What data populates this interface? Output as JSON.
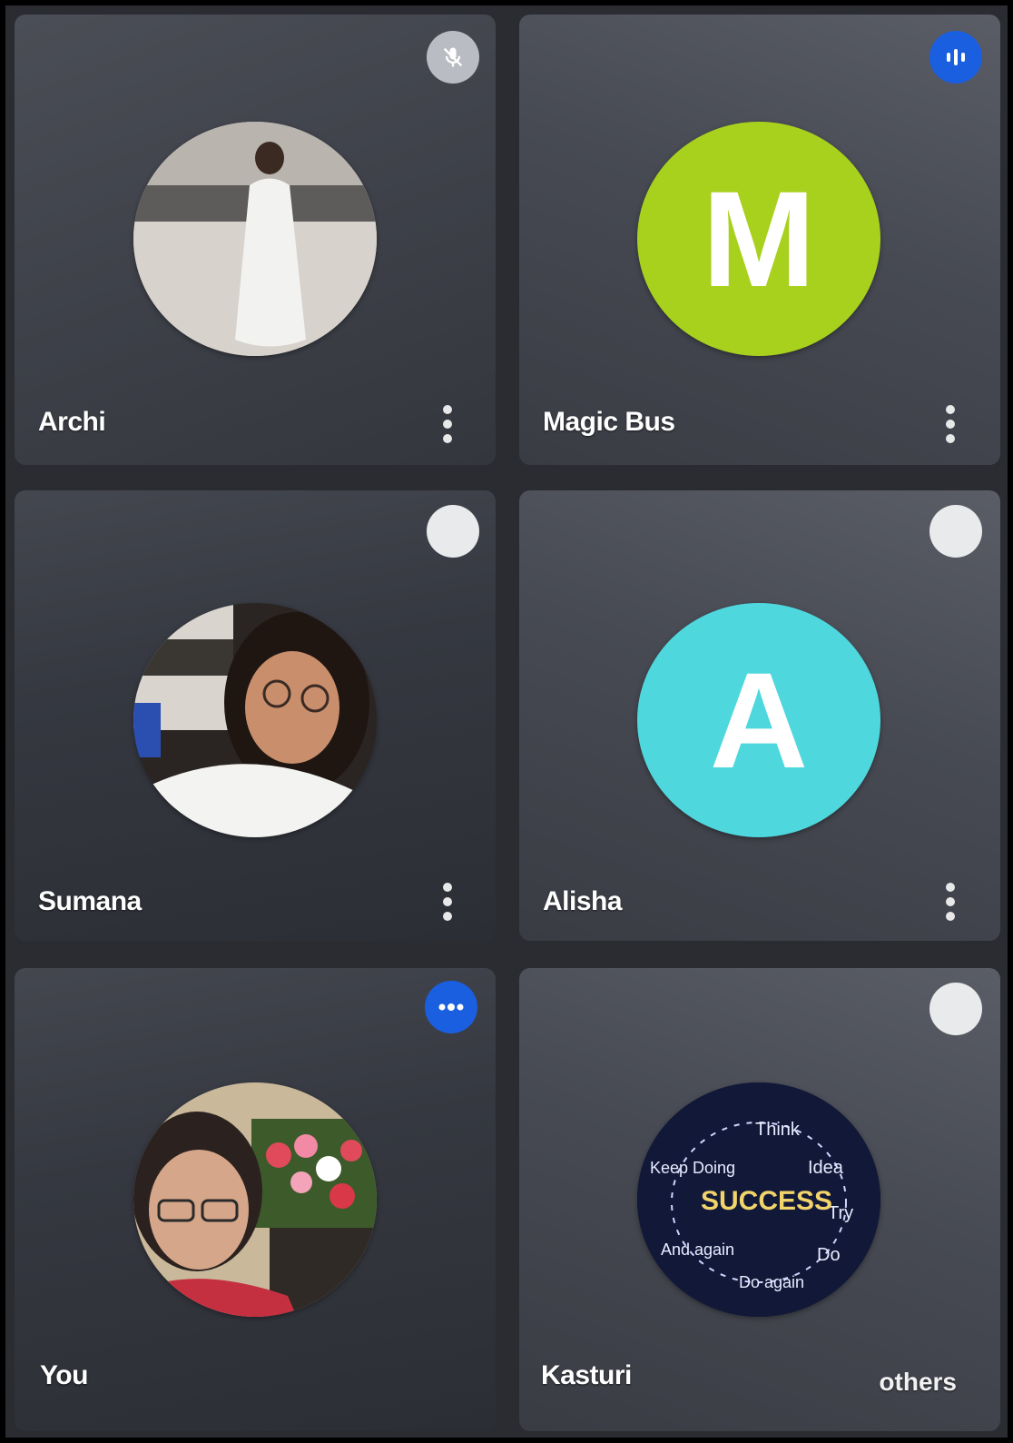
{
  "participants": [
    {
      "name": "Archi",
      "avatar": "photo",
      "status": "muted-mic-icon",
      "status_color": "#b9bcc2"
    },
    {
      "name": "Magic Bus",
      "avatar": "letter",
      "initial": "M",
      "avatar_color": "#a8d11e",
      "status": "speaking-icon",
      "status_color": "#1a5fe0"
    },
    {
      "name": "Sumana",
      "avatar": "photo",
      "status": "status-dot",
      "status_color": "#e9eaec"
    },
    {
      "name": "Alisha",
      "avatar": "letter",
      "initial": "A",
      "avatar_color": "#4fd7de",
      "status": "status-dot",
      "status_color": "#e9eaec"
    },
    {
      "name": "You",
      "avatar": "photo",
      "status": "speaking-dots-icon",
      "status_color": "#1a5fe0"
    },
    {
      "name": "Kasturi",
      "avatar": "photo",
      "status": "status-dot",
      "status_color": "#e9eaec"
    }
  ],
  "overflow_label": "others",
  "kasturi_avatar_words": [
    "Think",
    "Idea",
    "Try",
    "Do",
    "Do again",
    "And again",
    "Keep Doing",
    "SUCCESS"
  ]
}
